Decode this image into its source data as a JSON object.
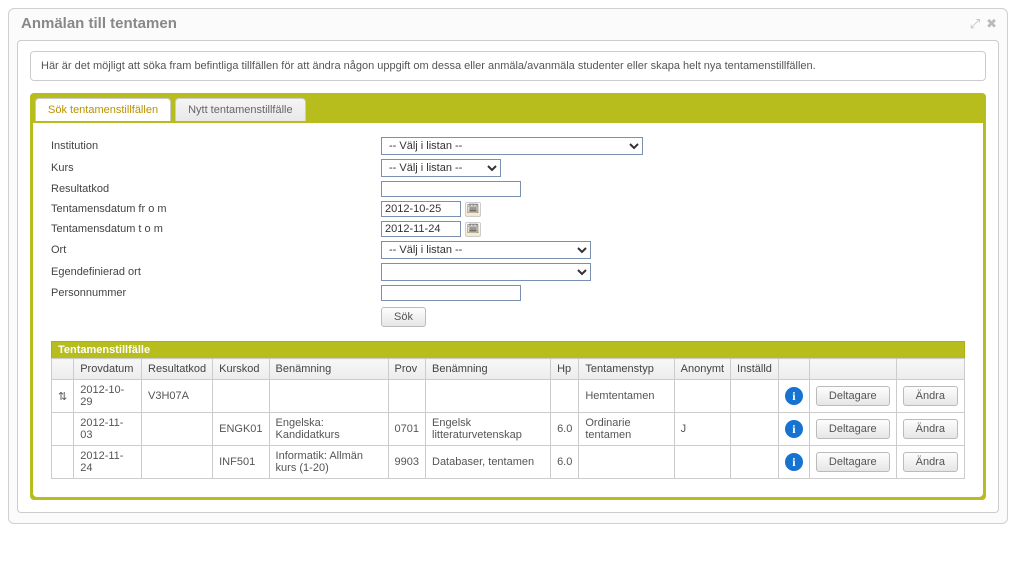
{
  "window": {
    "title": "Anmälan till tentamen"
  },
  "intro": "Här är det möjligt att söka fram befintliga tillfällen för att ändra någon uppgift om dessa eller anmäla/avanmäla studenter eller skapa helt nya tentamenstillfällen.",
  "tabs": [
    {
      "label": "Sök tentamenstillfällen",
      "active": true
    },
    {
      "label": "Nytt tentamenstillfälle",
      "active": false
    }
  ],
  "form": {
    "institution_label": "Institution",
    "institution_placeholder": "-- Välj i listan --",
    "kurs_label": "Kurs",
    "kurs_placeholder": "-- Välj i listan --",
    "resultatkod_label": "Resultatkod",
    "resultatkod_value": "",
    "datum_from_label": "Tentamensdatum fr o m",
    "datum_from_value": "2012-10-25",
    "datum_to_label": "Tentamensdatum t o m",
    "datum_to_value": "2012-11-24",
    "ort_label": "Ort",
    "ort_placeholder": "-- Välj i listan --",
    "egendef_ort_label": "Egendefinierad ort",
    "egendef_ort_value": "",
    "personnr_label": "Personnummer",
    "personnr_value": "",
    "search_label": "Sök"
  },
  "table": {
    "title": "Tentamenstillfälle",
    "headers": {
      "provdatum": "Provdatum",
      "resultatkod": "Resultatkod",
      "kurskod": "Kurskod",
      "benamning1": "Benämning",
      "prov": "Prov",
      "benamning2": "Benämning",
      "hp": "Hp",
      "tentamenstyp": "Tentamenstyp",
      "anonymt": "Anonymt",
      "installd": "Inställd"
    },
    "buttons": {
      "deltagare": "Deltagare",
      "andra": "Ändra"
    },
    "rows": [
      {
        "provdatum": "2012-10-29",
        "resultatkod": "V3H07A",
        "kurskod": "",
        "benamning1": "",
        "prov": "",
        "benamning2": "",
        "hp": "",
        "tentamenstyp": "Hemtentamen",
        "anonymt": "",
        "installd": ""
      },
      {
        "provdatum": "2012-11-03",
        "resultatkod": "",
        "kurskod": "ENGK01",
        "benamning1": "Engelska: Kandidatkurs",
        "prov": "0701",
        "benamning2": "Engelsk litteraturvetenskap",
        "hp": "6.0",
        "tentamenstyp": "Ordinarie tentamen",
        "anonymt": "J",
        "installd": ""
      },
      {
        "provdatum": "2012-11-24",
        "resultatkod": "",
        "kurskod": "INF501",
        "benamning1": "Informatik: Allmän kurs (1-20)",
        "prov": "9903",
        "benamning2": "Databaser, tentamen",
        "hp": "6.0",
        "tentamenstyp": "",
        "anonymt": "",
        "installd": ""
      }
    ]
  }
}
